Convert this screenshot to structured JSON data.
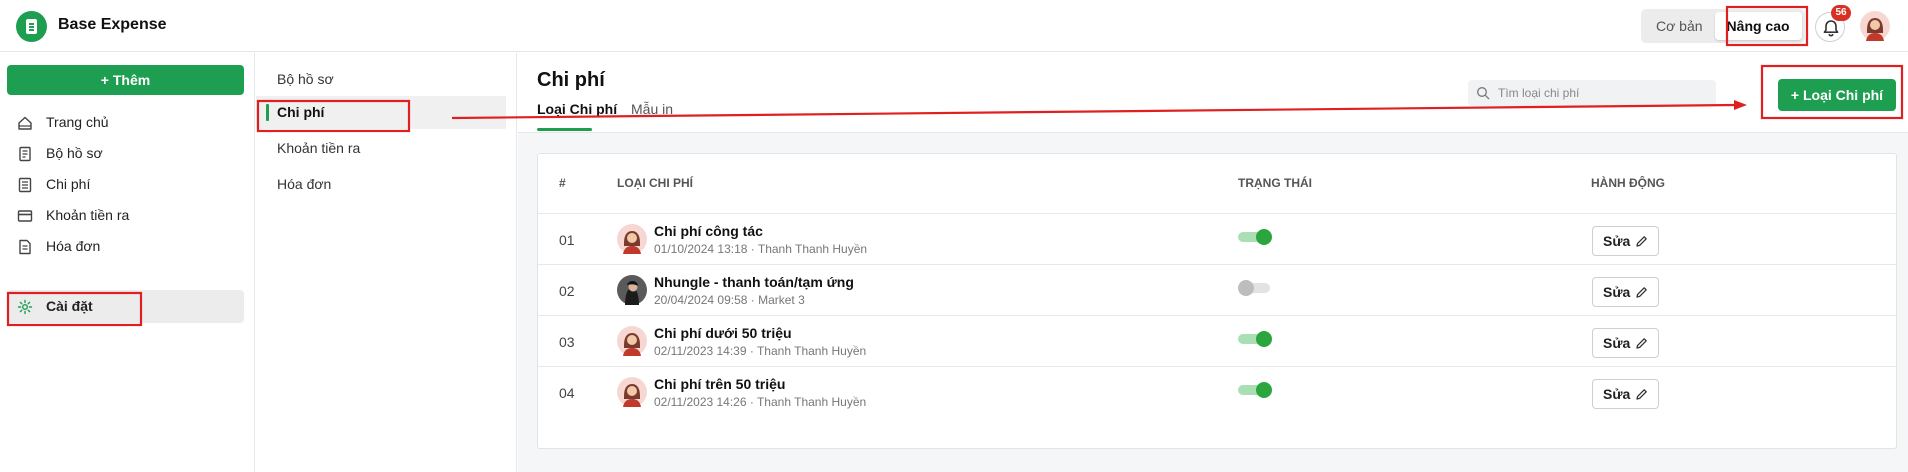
{
  "app": {
    "title": "Base Expense"
  },
  "header": {
    "modes": [
      "Cơ bản",
      "Nâng cao"
    ],
    "active_mode": "Nâng cao",
    "notifications_count": "56"
  },
  "sidebar": {
    "add_label": "+ Thêm",
    "items": [
      {
        "label": "Trang chủ",
        "icon": "home-icon"
      },
      {
        "label": "Bộ hồ sơ",
        "icon": "document-icon"
      },
      {
        "label": "Chi phí",
        "icon": "list-icon"
      },
      {
        "label": "Khoản tiền ra",
        "icon": "card-icon"
      },
      {
        "label": "Hóa đơn",
        "icon": "invoice-icon"
      },
      {
        "label": "Cài đặt",
        "icon": "gear-icon",
        "active": true
      }
    ]
  },
  "submenu": {
    "items": [
      "Bộ hồ sơ",
      "Chi phí",
      "Khoản tiền ra",
      "Hóa đơn"
    ],
    "active": "Chi phí"
  },
  "main": {
    "title": "Chi phí",
    "tabs": [
      "Loại Chi phí",
      "Mẫu in"
    ],
    "active_tab": "Loại Chi phí",
    "search_placeholder": "Tìm loại chi phí",
    "create_label": "+ Loại Chi phí",
    "table": {
      "headers": [
        "#",
        "Loại chi phí",
        "Trạng thái",
        "Hành động"
      ],
      "rows": [
        {
          "index": "01",
          "name": "Chi phí công tác",
          "meta": "01/10/2024 13:18 · Thanh Thanh Huyền",
          "enabled": true,
          "action": "Sửa"
        },
        {
          "index": "02",
          "name": "Nhungle - thanh toán/tạm ứng",
          "meta": "20/04/2024 09:58 · Market 3",
          "enabled": false,
          "action": "Sửa"
        },
        {
          "index": "03",
          "name": "Chi phí dưới 50 triệu",
          "meta": "02/11/2023 14:39 · Thanh Thanh Huyền",
          "enabled": true,
          "action": "Sửa"
        },
        {
          "index": "04",
          "name": "Chi phí trên 50 triệu",
          "meta": "02/11/2023 14:26 · Thanh Thanh Huyền",
          "enabled": true,
          "action": "Sửa"
        }
      ]
    }
  },
  "colors": {
    "brand": "#1e9e50",
    "annotation": "#e02020",
    "toggle_on": "#2aa63c",
    "toggle_off": "#bdbdbd"
  }
}
